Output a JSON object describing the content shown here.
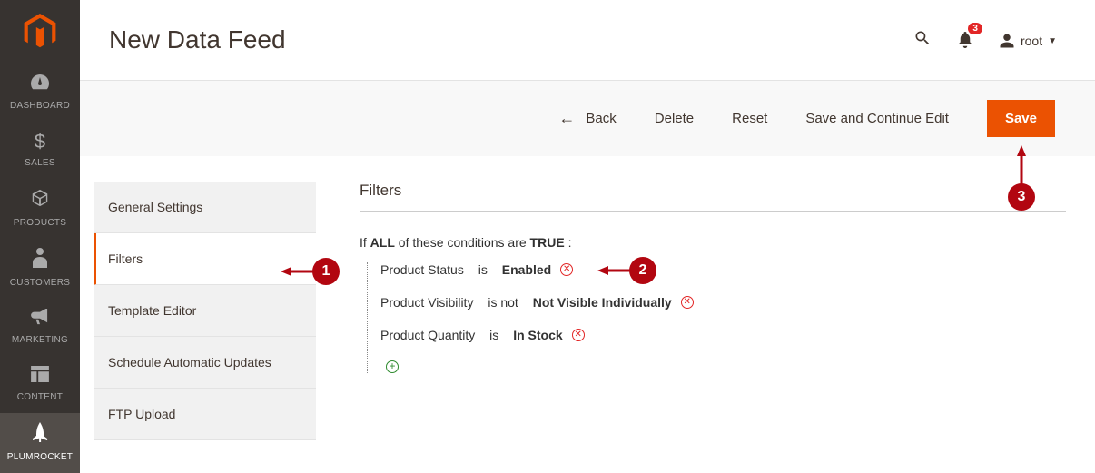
{
  "sidebar": {
    "items": [
      {
        "label": "DASHBOARD"
      },
      {
        "label": "SALES"
      },
      {
        "label": "PRODUCTS"
      },
      {
        "label": "CUSTOMERS"
      },
      {
        "label": "MARKETING"
      },
      {
        "label": "CONTENT"
      },
      {
        "label": "PLUMROCKET"
      }
    ]
  },
  "header": {
    "title": "New Data Feed",
    "notif_count": "3",
    "user": "root"
  },
  "actions": {
    "back": "Back",
    "delete": "Delete",
    "reset": "Reset",
    "save_continue": "Save and Continue Edit",
    "save": "Save"
  },
  "tabs": [
    {
      "label": "General Settings"
    },
    {
      "label": "Filters"
    },
    {
      "label": "Template Editor"
    },
    {
      "label": "Schedule Automatic Updates"
    },
    {
      "label": "FTP Upload"
    }
  ],
  "panel": {
    "title": "Filters",
    "cond_prefix": "If",
    "cond_aggr": "ALL",
    "cond_mid": " of these conditions are ",
    "cond_val": "TRUE",
    "cond_suffix": " :",
    "rows": [
      {
        "attr": "Product Status",
        "op": "is",
        "val": "Enabled"
      },
      {
        "attr": "Product Visibility",
        "op": "is not",
        "val": "Not Visible Individually"
      },
      {
        "attr": "Product Quantity",
        "op": "is",
        "val": "In Stock"
      }
    ]
  },
  "annotations": {
    "n1": "1",
    "n2": "2",
    "n3": "3"
  }
}
